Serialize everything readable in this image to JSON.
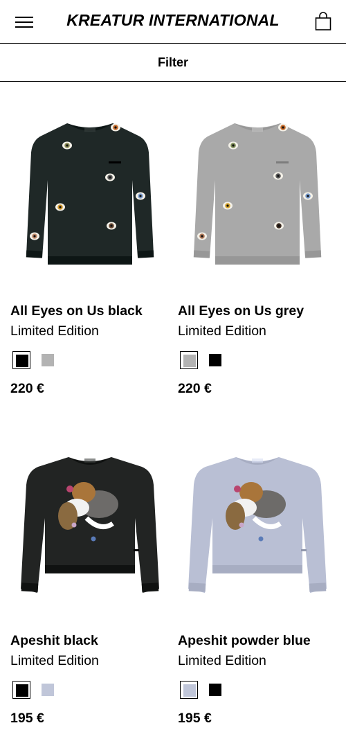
{
  "header": {
    "brand": "KREATUR INTERNATIONAL",
    "menu_icon": "hamburger-menu-icon",
    "cart_icon": "shopping-bag-icon"
  },
  "filter": {
    "label": "Filter"
  },
  "products": [
    {
      "title": "All Eyes on Us black",
      "subtitle": "Limited Edition",
      "price": "220 €",
      "garment_color": "#1f2827",
      "swatches": [
        "#000000",
        "#b3b3b3"
      ],
      "selected_swatch": 0
    },
    {
      "title": "All Eyes on Us grey",
      "subtitle": "Limited Edition",
      "price": "220 €",
      "garment_color": "#a9a9a9",
      "swatches": [
        "#b3b3b3",
        "#000000"
      ],
      "selected_swatch": 0
    },
    {
      "title": "Apeshit black",
      "subtitle": "Limited Edition",
      "price": "195 €",
      "garment_color": "#222423",
      "swatches": [
        "#000000",
        "#c0c6d9"
      ],
      "selected_swatch": 0
    },
    {
      "title": "Apeshit powder blue",
      "subtitle": "Limited Edition",
      "price": "195 €",
      "garment_color": "#b9bfd4",
      "swatches": [
        "#c0c6d9",
        "#000000"
      ],
      "selected_swatch": 0
    }
  ]
}
